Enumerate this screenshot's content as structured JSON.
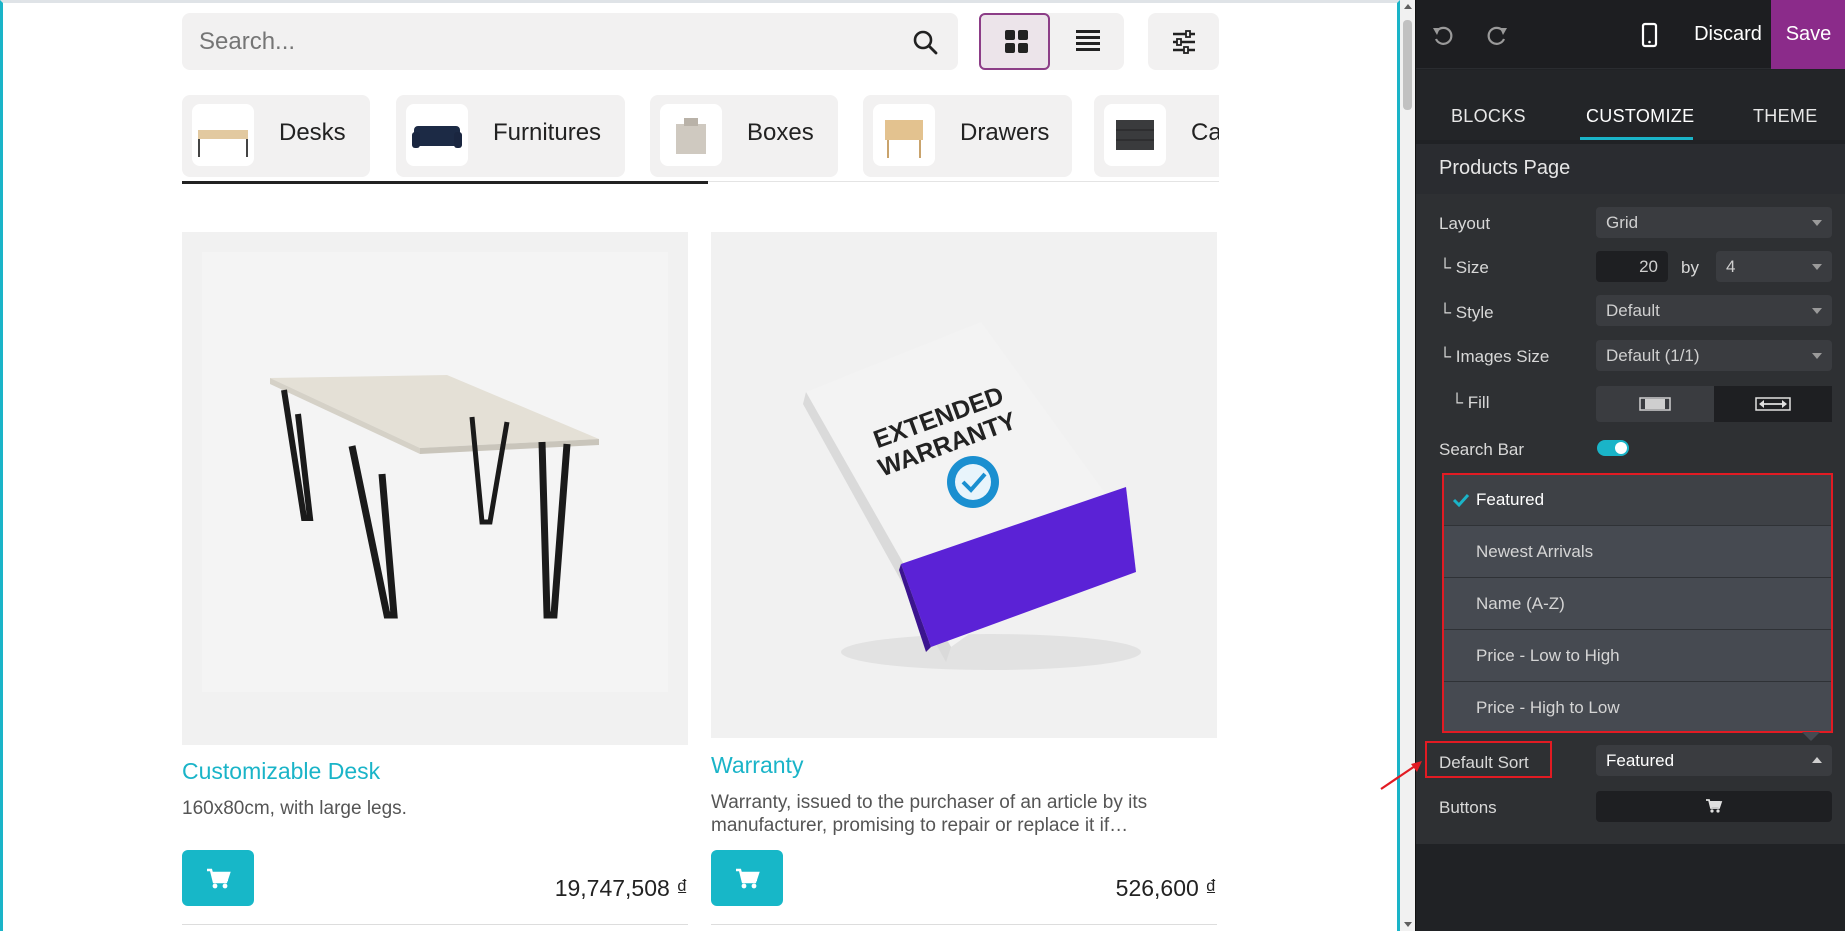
{
  "site": {
    "search": {
      "placeholder": "Search..."
    },
    "categories": [
      {
        "label": "Desks",
        "icon": "desk-thumbnail"
      },
      {
        "label": "Furnitures",
        "icon": "sofa-thumbnail"
      },
      {
        "label": "Boxes",
        "icon": "box-thumbnail"
      },
      {
        "label": "Drawers",
        "icon": "drawer-thumbnail"
      },
      {
        "label": "Ca",
        "icon": "cabinet-thumbnail"
      }
    ],
    "products": [
      {
        "name": "Customizable Desk",
        "description": "160x80cm, with large legs.",
        "price": "19,747,508 ₫",
        "image": "desk-photo"
      },
      {
        "name": "Warranty",
        "description": "Warranty, issued to the purchaser of an article by its manufacturer, promising to repair or replace it if…",
        "price": "526,600 ₫",
        "image": "warranty-box-photo",
        "box_text": [
          "EXTENDED",
          "WARRANTY"
        ]
      }
    ]
  },
  "editor": {
    "discard_label": "Discard",
    "save_label": "Save",
    "tabs": [
      "BLOCKS",
      "CUSTOMIZE",
      "THEME"
    ],
    "active_tab": "CUSTOMIZE",
    "section_title": "Products Page",
    "options": {
      "layout": {
        "label": "Layout",
        "value": "Grid"
      },
      "size": {
        "label": "└ Size",
        "rows": "20",
        "by": "by",
        "cols": "4"
      },
      "style": {
        "label": "└ Style",
        "value": "Default"
      },
      "images_size": {
        "label": "└ Images Size",
        "value": "Default (1/1)"
      },
      "fill": {
        "label": "└ Fill"
      },
      "search_bar": {
        "label": "Search Bar",
        "enabled": true
      },
      "default_sort": {
        "label": "Default Sort",
        "value": "Featured"
      },
      "buttons": {
        "label": "Buttons"
      }
    },
    "sort_options": [
      "Featured",
      "Newest Arrivals",
      "Name (A-Z)",
      "Price - Low to High",
      "Price - High to Low"
    ],
    "selected_sort": "Featured"
  },
  "colors": {
    "accent": "#1ab4c8",
    "brand": "#8b2b8a",
    "highlight": "#e21b23",
    "panel_bg": "#2e3033"
  }
}
